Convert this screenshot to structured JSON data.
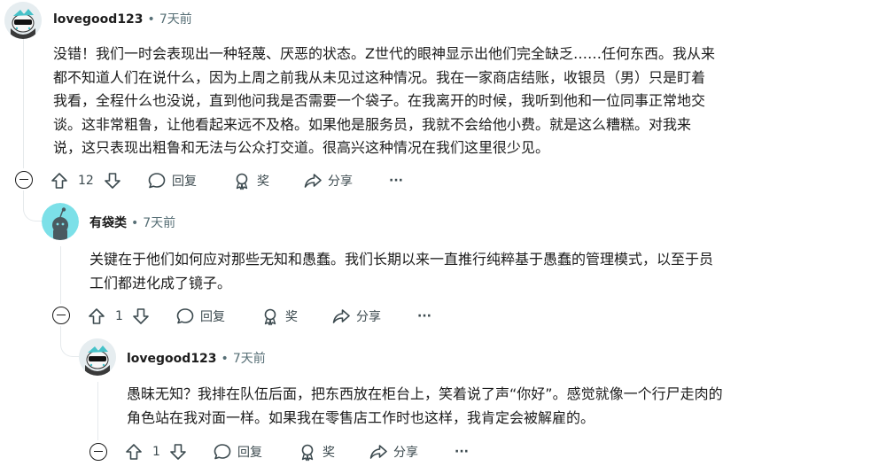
{
  "comments": [
    {
      "username": "lovegood123",
      "separator": "•",
      "time": "7天前",
      "lines": [
        "没错！我们一时会表现出一种轻蔑、厌恶的状态。Z世代的眼神显示出他们完全缺乏……任何东西。我从来",
        "都不知道人们在说什么，因为上周之前我从未见过这种情况。我在一家商店结账，收银员（男）只是盯着",
        "我看，全程什么也没说，直到他问我是否需要一个袋子。在我离开的时候，我听到他和一位同事正常地交",
        "谈。这非常粗鲁，让他看起来远不及格。如果他是服务员，我就不会给他小费。就是这么糟糕。对我来",
        "说，这只表现出粗鲁和无法与公众打交道。很高兴这种情况在我们这里很少见。"
      ],
      "votes": "12",
      "reply_label": "回复",
      "award_label": "奖",
      "share_label": "分享",
      "more_label": "···"
    },
    {
      "username": "有袋类",
      "separator": "•",
      "time": "7天前",
      "lines": [
        "关键在于他们如何应对那些无知和愚蠢。我们长期以来一直推行纯粹基于愚蠢的管理模式，以至于员",
        "工们都进化成了镜子。"
      ],
      "votes": "1",
      "reply_label": "回复",
      "award_label": "奖",
      "share_label": "分享",
      "more_label": "···"
    },
    {
      "username": "lovegood123",
      "separator": "•",
      "time": "7天前",
      "lines": [
        "愚昧无知？我排在队伍后面，把东西放在柜台上，笑着说了声“你好”。感觉就像一个行尸走肉的",
        "角色站在我对面一样。如果我在零售店工作时也这样，我肯定会被解雇的。"
      ],
      "votes": "1",
      "reply_label": "回复",
      "award_label": "奖",
      "share_label": "分享",
      "more_label": "···"
    }
  ]
}
